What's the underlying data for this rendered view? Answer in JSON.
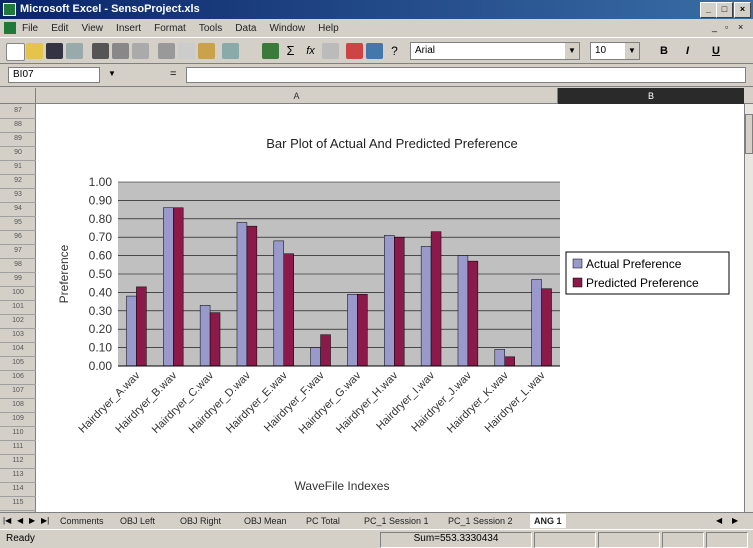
{
  "window": {
    "title": "Microsoft Excel - SensoProject.xls"
  },
  "menu": [
    "File",
    "Edit",
    "View",
    "Insert",
    "Format",
    "Tools",
    "Data",
    "Window",
    "Help"
  ],
  "toolbar": {
    "font_name": "Arial",
    "font_size": "10",
    "bold": "B",
    "italic": "I",
    "underline": "U"
  },
  "formula_bar": {
    "name_box": "BI07",
    "fx": "="
  },
  "column_headers": {
    "a": "A",
    "b": "B"
  },
  "row_headers": [
    "87",
    "88",
    "89",
    "90",
    "91",
    "92",
    "93",
    "94",
    "95",
    "96",
    "97",
    "98",
    "99",
    "100",
    "101",
    "102",
    "103",
    "104",
    "105",
    "106",
    "107",
    "108",
    "109",
    "110",
    "111",
    "112",
    "113",
    "114",
    "115"
  ],
  "chart_data": {
    "type": "bar",
    "title": "Bar Plot of Actual And Predicted Preference",
    "xlabel": "WaveFile Indexes",
    "ylabel": "Preference",
    "ylim": [
      0,
      1
    ],
    "yticks": [
      "0.00",
      "0.10",
      "0.20",
      "0.30",
      "0.40",
      "0.50",
      "0.60",
      "0.70",
      "0.80",
      "0.90",
      "1.00"
    ],
    "grid": true,
    "legend_position": "right",
    "categories": [
      "Hairdryer_A.wav",
      "Hairdryer_B.wav",
      "Hairdryer_C.wav",
      "Hairdryer_D.wav",
      "Hairdryer_E.wav",
      "Hairdryer_F.wav",
      "Hairdryer_G.wav",
      "Hairdryer_H.wav",
      "Hairdryer_I.wav",
      "Hairdryer_J.wav",
      "Hairdryer_K.wav",
      "Hairdryer_L.wav"
    ],
    "series": [
      {
        "name": "Actual Preference",
        "color": "#9999cc",
        "values": [
          0.38,
          0.86,
          0.33,
          0.78,
          0.68,
          0.1,
          0.39,
          0.71,
          0.65,
          0.6,
          0.09,
          0.47
        ]
      },
      {
        "name": "Predicted Preference",
        "color": "#8b1a4a",
        "values": [
          0.43,
          0.86,
          0.29,
          0.76,
          0.61,
          0.17,
          0.39,
          0.7,
          0.73,
          0.57,
          0.05,
          0.42
        ]
      }
    ],
    "plot_background": "#c0c0c0"
  },
  "sheet_tabs": [
    "Comments",
    "OBJ Left",
    "OBJ Right",
    "OBJ Mean",
    "PC Total",
    "PC_1 Session 1",
    "PC_1 Session 2",
    "ANG 1"
  ],
  "status": {
    "ready": "Ready",
    "sum": "Sum=553.3330434"
  }
}
